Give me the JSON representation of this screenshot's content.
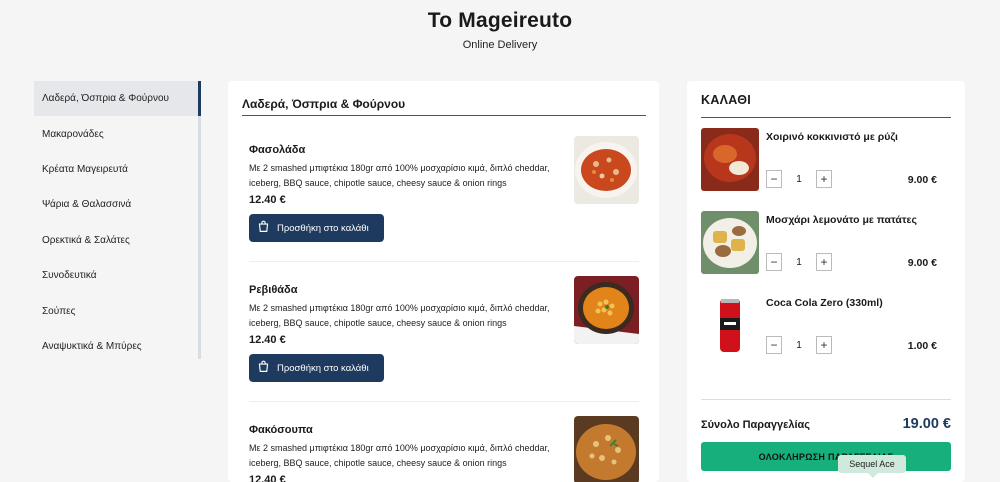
{
  "header": {
    "brand": "To Mageireuto",
    "tagline": "Online Delivery"
  },
  "sidebar": {
    "items": [
      {
        "label": "Λαδερά, Όσπρια & Φούρνου",
        "active": true
      },
      {
        "label": "Μακαρονάδες"
      },
      {
        "label": "Κρέατα Μαγειρευτά"
      },
      {
        "label": "Ψάρια & Θαλασσινά"
      },
      {
        "label": "Ορεκτικά & Σαλάτες"
      },
      {
        "label": "Συνοδευτικά"
      },
      {
        "label": "Σούπες"
      },
      {
        "label": "Αναψυκτικά & Μπύρες"
      }
    ]
  },
  "menu": {
    "title": "Λαδερά, Όσπρια & Φούρνου",
    "add_label": "Προσθήκη στο καλάθι",
    "items": [
      {
        "name": "Φασολάδα",
        "desc": "Με 2 smashed μπιφτέκια 180gr από 100% μοσχαρίσιο κιμά, διπλό cheddar, iceberg, BBQ sauce, chipotle sauce, cheesy sauce & onion rings",
        "price": "12.40 €"
      },
      {
        "name": "Ρεβιθάδα",
        "desc": "Με 2 smashed μπιφτέκια 180gr από 100% μοσχαρίσιο κιμά, διπλό cheddar, iceberg, BBQ sauce, chipotle sauce, cheesy sauce & onion rings",
        "price": "12.40 €"
      },
      {
        "name": "Φακόσουπα",
        "desc": "Με 2 smashed μπιφτέκια 180gr από 100% μοσχαρίσιο κιμά, διπλό cheddar, iceberg, BBQ sauce, chipotle sauce, cheesy sauce & onion rings",
        "price": "12.40 €"
      }
    ]
  },
  "cart": {
    "title": "ΚΑΛΑΘΙ",
    "items": [
      {
        "name": "Χοιρινό κοκκινιστό με ρύζι",
        "qty": "1",
        "price": "9.00 €"
      },
      {
        "name": "Μοσχάρι λεμονάτο με πατάτες",
        "qty": "1",
        "price": "9.00 €"
      },
      {
        "name": "Coca Cola Zero (330ml)",
        "qty": "1",
        "price": "1.00 €"
      }
    ],
    "total_label": "Σύνολο Παραγγελίας",
    "total_value": "19.00 €",
    "checkout_label": "ΟΛΟΚΛΗΡΩΣΗ ΠΑΡΑΓΓΕΛΙΑΣ"
  },
  "tooltip": {
    "text": "Sequel Ace"
  },
  "icons": {
    "add_button_icon": "shopping-bag-icon",
    "minus": "minus-icon",
    "plus": "plus-icon"
  },
  "colors": {
    "primary": "#1e3a5f",
    "checkout": "#17b07d",
    "background": "#f4f5f4"
  }
}
